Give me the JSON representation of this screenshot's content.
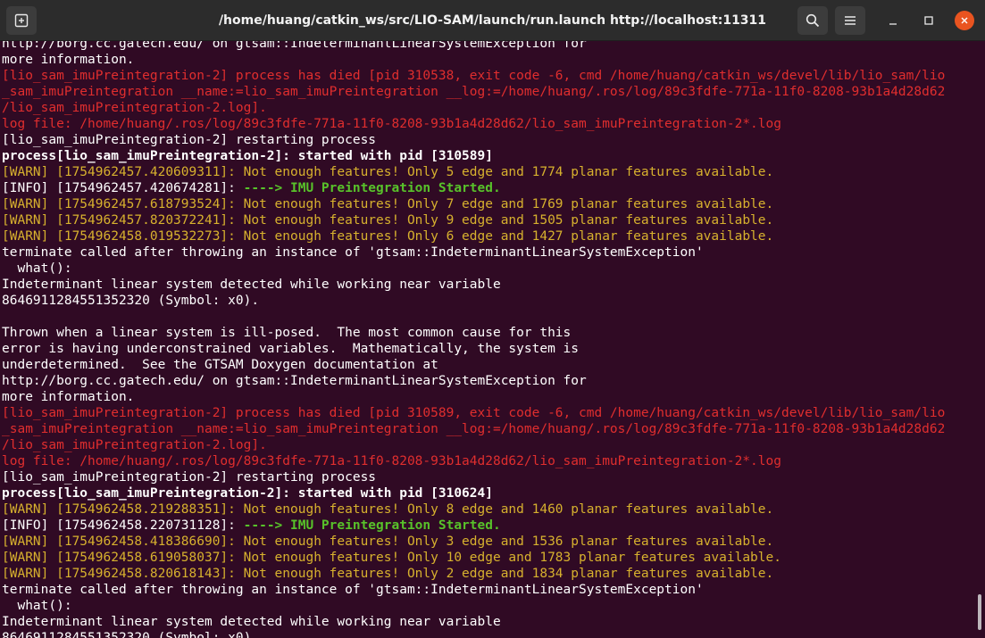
{
  "window": {
    "title": "/home/huang/catkin_ws/src/LIO-SAM/launch/run.launch http://localhost:11311",
    "icons": {
      "new_tab": "new-tab-icon",
      "search": "search-icon",
      "menu": "hamburger-menu-icon",
      "minimize": "minimize-icon",
      "maximize": "maximize-icon",
      "close": "close-icon"
    },
    "colors": {
      "terminal_bg": "#300a24",
      "titlebar_bg": "#2c2c2c",
      "error_red": "#e02e2e",
      "warn_yellow": "#d7b12e",
      "info_green": "#58c22a",
      "close_orange": "#e95420"
    }
  },
  "terminal": {
    "lines": [
      {
        "text": "http://borg.cc.gatech.edu/ on gtsam::IndeterminantLinearSystemException for",
        "style": "normal"
      },
      {
        "text": "more information.",
        "style": "normal"
      },
      {
        "text": "[lio_sam_imuPreintegration-2] process has died [pid 310538, exit code -6, cmd /home/huang/catkin_ws/devel/lib/lio_sam/lio",
        "style": "red"
      },
      {
        "text": "_sam_imuPreintegration __name:=lio_sam_imuPreintegration __log:=/home/huang/.ros/log/89c3fdfe-771a-11f0-8208-93b1a4d28d62",
        "style": "red"
      },
      {
        "text": "/lio_sam_imuPreintegration-2.log].",
        "style": "red"
      },
      {
        "text": "log file: /home/huang/.ros/log/89c3fdfe-771a-11f0-8208-93b1a4d28d62/lio_sam_imuPreintegration-2*.log",
        "style": "red"
      },
      {
        "text": "[lio_sam_imuPreintegration-2] restarting process",
        "style": "normal"
      },
      {
        "text": "process[lio_sam_imuPreintegration-2]: started with pid [310589]",
        "style": "bold"
      },
      {
        "text": "[WARN] [1754962457.420609311]: Not enough features! Only 5 edge and 1774 planar features available.",
        "style": "warn"
      },
      {
        "text": "[INFO] [1754962457.420674281]: ",
        "style": "info",
        "suffix": "----> IMU Preintegration Started."
      },
      {
        "text": "[WARN] [1754962457.618793524]: Not enough features! Only 7 edge and 1769 planar features available.",
        "style": "warn"
      },
      {
        "text": "[WARN] [1754962457.820372241]: Not enough features! Only 9 edge and 1505 planar features available.",
        "style": "warn"
      },
      {
        "text": "[WARN] [1754962458.019532273]: Not enough features! Only 6 edge and 1427 planar features available.",
        "style": "warn"
      },
      {
        "text": "terminate called after throwing an instance of 'gtsam::IndeterminantLinearSystemException'",
        "style": "normal"
      },
      {
        "text": "  what():",
        "style": "normal"
      },
      {
        "text": "Indeterminant linear system detected while working near variable",
        "style": "normal"
      },
      {
        "text": "8646911284551352320 (Symbol: x0).",
        "style": "normal"
      },
      {
        "text": "",
        "style": "normal"
      },
      {
        "text": "Thrown when a linear system is ill-posed.  The most common cause for this",
        "style": "normal"
      },
      {
        "text": "error is having underconstrained variables.  Mathematically, the system is",
        "style": "normal"
      },
      {
        "text": "underdetermined.  See the GTSAM Doxygen documentation at",
        "style": "normal"
      },
      {
        "text": "http://borg.cc.gatech.edu/ on gtsam::IndeterminantLinearSystemException for",
        "style": "normal"
      },
      {
        "text": "more information.",
        "style": "normal"
      },
      {
        "text": "[lio_sam_imuPreintegration-2] process has died [pid 310589, exit code -6, cmd /home/huang/catkin_ws/devel/lib/lio_sam/lio",
        "style": "red"
      },
      {
        "text": "_sam_imuPreintegration __name:=lio_sam_imuPreintegration __log:=/home/huang/.ros/log/89c3fdfe-771a-11f0-8208-93b1a4d28d62",
        "style": "red"
      },
      {
        "text": "/lio_sam_imuPreintegration-2.log].",
        "style": "red"
      },
      {
        "text": "log file: /home/huang/.ros/log/89c3fdfe-771a-11f0-8208-93b1a4d28d62/lio_sam_imuPreintegration-2*.log",
        "style": "red"
      },
      {
        "text": "[lio_sam_imuPreintegration-2] restarting process",
        "style": "normal"
      },
      {
        "text": "process[lio_sam_imuPreintegration-2]: started with pid [310624]",
        "style": "bold"
      },
      {
        "text": "[WARN] [1754962458.219288351]: Not enough features! Only 8 edge and 1460 planar features available.",
        "style": "warn"
      },
      {
        "text": "[INFO] [1754962458.220731128]: ",
        "style": "info",
        "suffix": "----> IMU Preintegration Started."
      },
      {
        "text": "[WARN] [1754962458.418386690]: Not enough features! Only 3 edge and 1536 planar features available.",
        "style": "warn"
      },
      {
        "text": "[WARN] [1754962458.619058037]: Not enough features! Only 10 edge and 1783 planar features available.",
        "style": "warn"
      },
      {
        "text": "[WARN] [1754962458.820618143]: Not enough features! Only 2 edge and 1834 planar features available.",
        "style": "warn"
      },
      {
        "text": "terminate called after throwing an instance of 'gtsam::IndeterminantLinearSystemException'",
        "style": "normal"
      },
      {
        "text": "  what():",
        "style": "normal"
      },
      {
        "text": "Indeterminant linear system detected while working near variable",
        "style": "normal"
      },
      {
        "text": "8646911284551352320 (Symbol: x0).",
        "style": "normal"
      }
    ]
  }
}
